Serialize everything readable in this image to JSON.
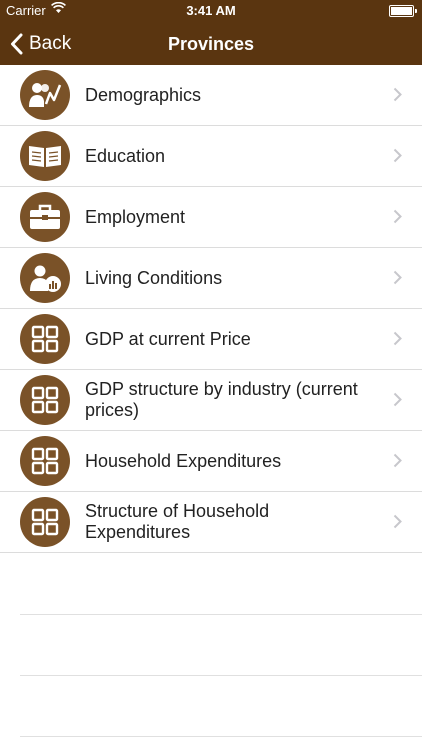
{
  "status": {
    "carrier": "Carrier",
    "time": "3:41 AM"
  },
  "nav": {
    "back_label": "Back",
    "title": "Provinces"
  },
  "colors": {
    "header": "#5a3510",
    "icon_bg": "#7a5228"
  },
  "items": [
    {
      "label": "Demographics",
      "icon": "demographics-icon"
    },
    {
      "label": "Education",
      "icon": "book-icon"
    },
    {
      "label": "Employment",
      "icon": "briefcase-icon"
    },
    {
      "label": "Living Conditions",
      "icon": "living-conditions-icon"
    },
    {
      "label": "GDP at current Price",
      "icon": "grid-icon"
    },
    {
      "label": "GDP structure by industry (current prices)",
      "icon": "grid-icon"
    },
    {
      "label": "Household Expenditures",
      "icon": "grid-icon"
    },
    {
      "label": "Structure of Household Expenditures",
      "icon": "grid-icon"
    }
  ]
}
